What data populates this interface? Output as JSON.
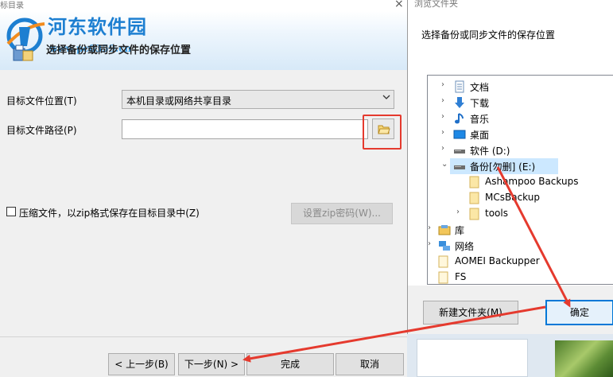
{
  "wizard": {
    "title": "标目录",
    "close_glyph": "×",
    "banner_title": "选择备份或同步文件的保存位置",
    "watermark": {
      "name": "河东软件园",
      "url": "www.pc0359.cn"
    },
    "location_label": "目标文件位置(T)",
    "location_value": "本机目录或网络共享目录",
    "path_label": "目标文件路径(P)",
    "path_value": "",
    "zip_label": "压缩文件，以zip格式保存在目标目录中(Z)",
    "zip_pwd_button": "设置zip密码(W)...",
    "buttons": {
      "prev": "< 上一步(B)",
      "next": "下一步(N) >",
      "finish": "完成",
      "cancel": "取消"
    }
  },
  "browse_dialog": {
    "title": "浏览文件夹",
    "prompt": "选择备份或同步文件的保存位置",
    "tree": [
      {
        "label": "文档",
        "icon": "documents-icon",
        "expander": "›"
      },
      {
        "label": "下载",
        "icon": "download-icon",
        "expander": "›"
      },
      {
        "label": "音乐",
        "icon": "music-icon",
        "expander": "›"
      },
      {
        "label": "桌面",
        "icon": "desktop-icon",
        "expander": "›"
      },
      {
        "label": "软件 (D:)",
        "icon": "drive-icon",
        "expander": "›"
      },
      {
        "label": "备份[勿删] (E:)",
        "icon": "drive-icon",
        "expander": "⌄",
        "selected": true
      },
      {
        "label": "Ashampoo Backups",
        "icon": "folder-icon",
        "expander": ""
      },
      {
        "label": "MCsBackup",
        "icon": "folder-icon",
        "expander": ""
      },
      {
        "label": "tools",
        "icon": "folder-icon",
        "expander": "›"
      },
      {
        "label": "库",
        "icon": "library-icon",
        "expander": "›"
      },
      {
        "label": "网络",
        "icon": "network-icon",
        "expander": "›"
      },
      {
        "label": "AOMEI Backupper",
        "icon": "folder-icon",
        "expander": ""
      },
      {
        "label": "FS",
        "icon": "folder-icon",
        "expander": ""
      }
    ],
    "new_folder_button": "新建文件夹(M)",
    "ok_button": "确定"
  },
  "colors": {
    "highlight_red": "#e53a2e",
    "selection": "#cce8ff",
    "focus_blue": "#0078d7",
    "watermark_blue": "#1d7fd1"
  }
}
